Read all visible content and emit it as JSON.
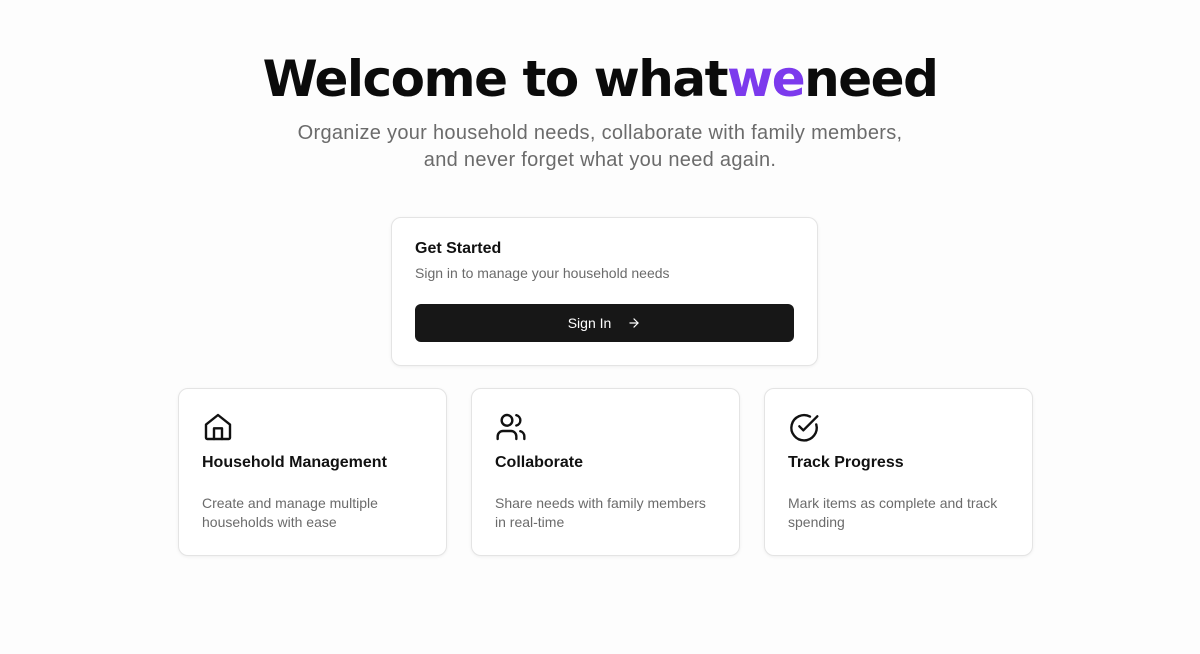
{
  "hero": {
    "title_prefix": "Welcome to what",
    "title_accent": "we",
    "title_suffix": "need",
    "subtitle": "Organize your household needs, collaborate with family members, and never forget what you need again."
  },
  "signin_card": {
    "title": "Get Started",
    "description": "Sign in to manage your household needs",
    "button_label": "Sign In",
    "button_icon": "arrow-right-icon"
  },
  "features": [
    {
      "icon": "house-icon",
      "title": "Household Management",
      "description": "Create and manage multiple households with ease"
    },
    {
      "icon": "users-icon",
      "title": "Collaborate",
      "description": "Share needs with family members in real-time"
    },
    {
      "icon": "check-circle-icon",
      "title": "Track Progress",
      "description": "Mark items as complete and track spending"
    }
  ],
  "colors": {
    "accent": "#7c3aed",
    "button_bg": "#171717",
    "muted_text": "#6b6b6b"
  }
}
